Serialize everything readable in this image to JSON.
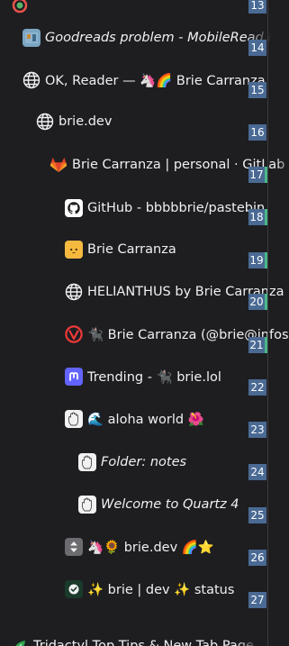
{
  "tabs": [
    {
      "id": "partial-13",
      "title": "",
      "italic": false,
      "icon": "green-ring-icon",
      "number": "13",
      "green": false
    },
    {
      "id": "goodreads",
      "title": "Goodreads problem - MobileRead Forums",
      "italic": true,
      "icon": "book-icon",
      "number": "14",
      "green": false
    },
    {
      "id": "ok-reader",
      "title": "OK, Reader — 🦄🌈 Brie Carranza",
      "italic": false,
      "icon": "globe-icon",
      "number": "15",
      "green": false
    },
    {
      "id": "brie-dev",
      "title": "brie.dev",
      "italic": false,
      "icon": "globe-icon",
      "number": "16",
      "green": false
    },
    {
      "id": "gitlab",
      "title": "Brie Carranza | personal · GitLab",
      "italic": false,
      "icon": "gitlab-icon",
      "number": "17",
      "green": true
    },
    {
      "id": "github",
      "title": "GitHub - bbbbbrie/pastebin",
      "italic": false,
      "icon": "github-icon",
      "number": "18",
      "green": true
    },
    {
      "id": "brie-cat",
      "title": "Brie Carranza",
      "italic": false,
      "icon": "cat-icon",
      "number": "19",
      "green": true
    },
    {
      "id": "helianthus",
      "title": "HELIANTHUS by Brie Carranza",
      "italic": false,
      "icon": "globe-icon",
      "number": "20",
      "green": true
    },
    {
      "id": "brie-at",
      "title": "🐈‍⬛ Brie Carranza (@brie@infosec.exchange)",
      "italic": false,
      "icon": "vivaldi-icon",
      "number": "21",
      "green": true
    },
    {
      "id": "trending",
      "title": "Trending - 🐈‍⬛ brie.lol",
      "italic": false,
      "icon": "mastodon-icon",
      "number": "22",
      "green": false
    },
    {
      "id": "aloha",
      "title": "🌊 aloha world 🌺",
      "italic": false,
      "icon": "hand-icon",
      "number": "23",
      "green": false
    },
    {
      "id": "folder-notes",
      "title": "Folder: notes",
      "italic": true,
      "icon": "hand-icon",
      "number": "24",
      "green": false
    },
    {
      "id": "quartz",
      "title": "Welcome to Quartz 4",
      "italic": true,
      "icon": "hand-icon",
      "number": "25",
      "green": false
    },
    {
      "id": "brie-dev-2",
      "title": "🦄🌻 brie.dev 🌈⭐",
      "italic": false,
      "icon": "arrows-icon",
      "number": "26",
      "green": false
    },
    {
      "id": "status",
      "title": "✨ brie | dev ✨ status",
      "italic": false,
      "icon": "check-icon",
      "number": "27",
      "green": false
    },
    {
      "id": "tridactyl",
      "title": "Tridactyl Top Tips & New Tab Page",
      "italic": false,
      "icon": "leaf-icon",
      "number": "",
      "green": false
    }
  ]
}
